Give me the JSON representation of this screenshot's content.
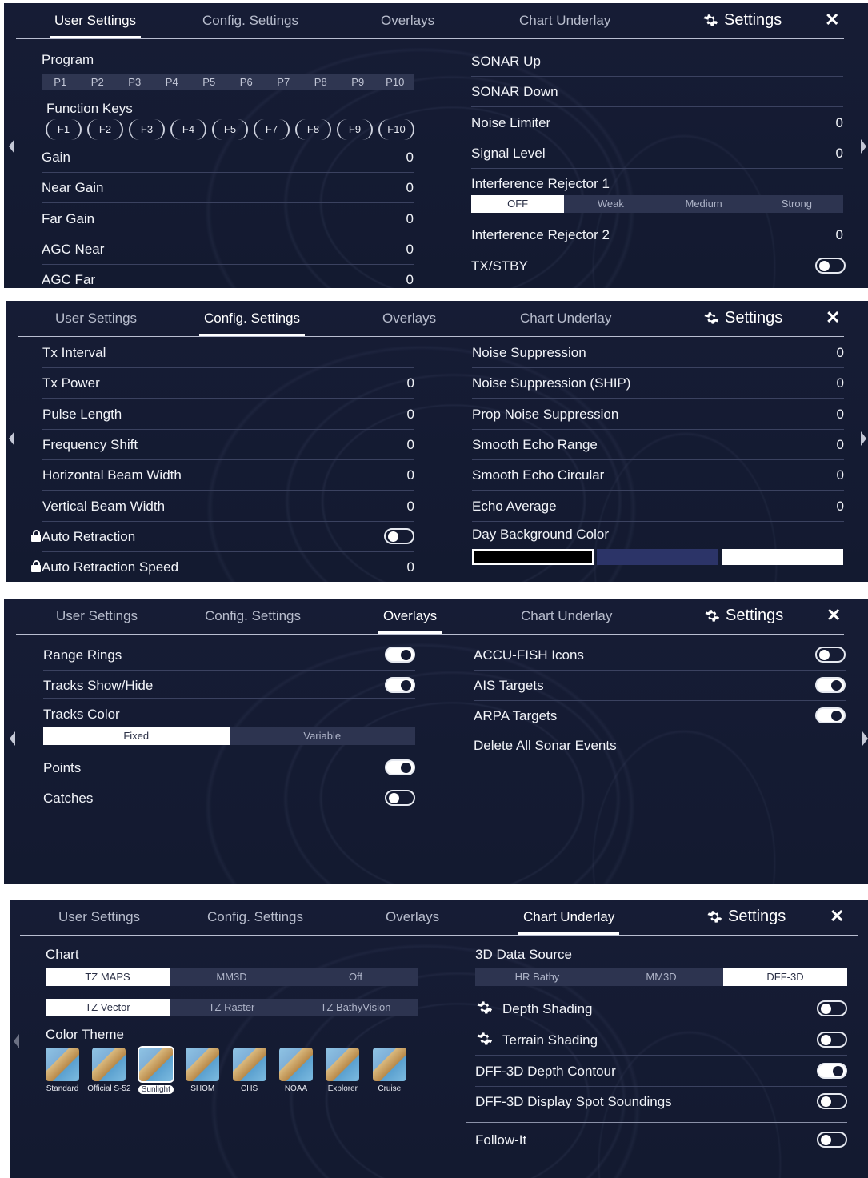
{
  "tabs": [
    "User Settings",
    "Config. Settings",
    "Overlays",
    "Chart Underlay"
  ],
  "settings_label": "Settings",
  "close_label": "✕",
  "panel1": {
    "program_label": "Program",
    "programs": [
      "P1",
      "P2",
      "P3",
      "P4",
      "P5",
      "P6",
      "P7",
      "P8",
      "P9",
      "P10"
    ],
    "function_keys_label": "Function Keys",
    "function_keys": [
      "F1",
      "F2",
      "F3",
      "F4",
      "F5",
      "F7",
      "F8",
      "F9",
      "F10"
    ],
    "left_rows": [
      {
        "label": "Gain",
        "value": "0"
      },
      {
        "label": "Near Gain",
        "value": "0"
      },
      {
        "label": "Far Gain",
        "value": "0"
      },
      {
        "label": "AGC Near",
        "value": "0"
      },
      {
        "label": "AGC Far",
        "value": "0"
      }
    ],
    "right_rows": [
      {
        "label": "SONAR Up",
        "value": ""
      },
      {
        "label": "SONAR Down",
        "value": ""
      },
      {
        "label": "Noise Limiter",
        "value": "0"
      },
      {
        "label": "Signal Level",
        "value": "0"
      }
    ],
    "interference_rejector_1": {
      "label": "Interference Rejector 1",
      "options": [
        "OFF",
        "Weak",
        "Medium",
        "Strong"
      ],
      "selected": "OFF"
    },
    "interference_rejector_2": {
      "label": "Interference Rejector 2",
      "value": "0"
    },
    "tx_stby": {
      "label": "TX/STBY",
      "on": false
    }
  },
  "panel2": {
    "left_rows": [
      {
        "label": "Tx Interval",
        "value": ""
      },
      {
        "label": "Tx Power",
        "value": "0"
      },
      {
        "label": "Pulse Length",
        "value": "0"
      },
      {
        "label": "Frequency Shift",
        "value": "0"
      },
      {
        "label": "Horizontal Beam Width",
        "value": "0"
      },
      {
        "label": "Vertical Beam Width",
        "value": "0"
      }
    ],
    "auto_retraction": {
      "label": "Auto Retraction",
      "on": false
    },
    "auto_retraction_speed": {
      "label": "Auto Retraction Speed",
      "value": "0"
    },
    "right_rows": [
      {
        "label": "Noise Suppression",
        "value": "0"
      },
      {
        "label": "Noise Suppression (SHIP)",
        "value": "0"
      },
      {
        "label": "Prop Noise Suppression",
        "value": "0"
      },
      {
        "label": "Smooth Echo Range",
        "value": "0"
      },
      {
        "label": "Smooth Echo Circular",
        "value": "0"
      },
      {
        "label": "Echo Average",
        "value": "0"
      }
    ],
    "day_background_color": {
      "label": "Day Background Color",
      "colors": [
        "#000000",
        "#2c3468",
        "#ffffff"
      ],
      "selected_index": 0
    }
  },
  "panel3": {
    "range_rings": {
      "label": "Range Rings",
      "on": true
    },
    "tracks_show_hide": {
      "label": "Tracks Show/Hide",
      "on": true
    },
    "tracks_color": {
      "label": "Tracks Color",
      "options": [
        "Fixed",
        "Variable"
      ],
      "selected": "Fixed"
    },
    "points": {
      "label": "Points",
      "on": true
    },
    "catches": {
      "label": "Catches",
      "on": false
    },
    "accu_fish": {
      "label": "ACCU-FISH Icons",
      "on": false
    },
    "ais_targets": {
      "label": "AIS Targets",
      "on": true
    },
    "arpa_targets": {
      "label": "ARPA Targets",
      "on": true
    },
    "delete_all": {
      "label": "Delete All Sonar Events"
    }
  },
  "panel4": {
    "chart_label": "Chart",
    "chart_options": [
      "TZ MAPS",
      "MM3D",
      "Off"
    ],
    "chart_selected": "TZ MAPS",
    "chart_type_options": [
      "TZ Vector",
      "TZ Raster",
      "TZ BathyVision"
    ],
    "chart_type_selected": "TZ Vector",
    "color_theme_label": "Color Theme",
    "themes": [
      "Standard",
      "Official S-52",
      "Sunlight",
      "SHOM",
      "CHS",
      "NOAA",
      "Explorer",
      "Cruise"
    ],
    "theme_selected": "Sunlight",
    "data_source_label": "3D Data Source",
    "data_source_options": [
      "HR Bathy",
      "MM3D",
      "DFF-3D"
    ],
    "data_source_selected": "DFF-3D",
    "depth_shading": {
      "label": "Depth Shading",
      "on": false
    },
    "terrain_shading": {
      "label": "Terrain Shading",
      "on": false
    },
    "dff_depth_contour": {
      "label": "DFF-3D Depth Contour",
      "on": true
    },
    "dff_spot_soundings": {
      "label": "DFF-3D Display Spot Soundings",
      "on": false
    },
    "follow_it": {
      "label": "Follow-It",
      "on": false
    }
  }
}
